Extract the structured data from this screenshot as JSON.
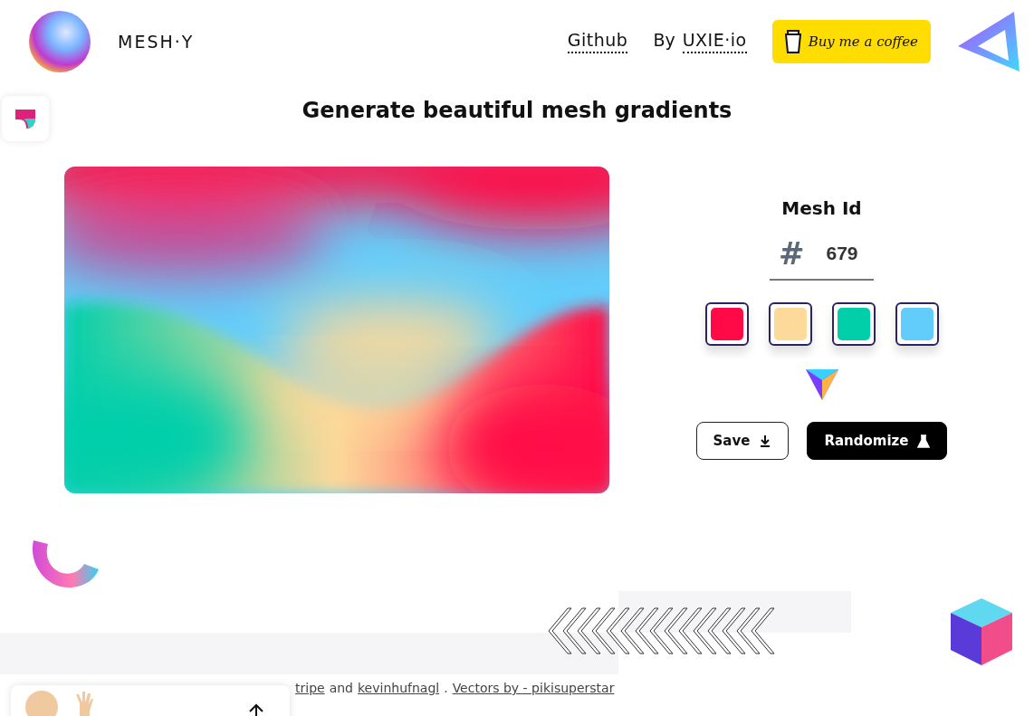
{
  "header": {
    "logo_text": "MESH·Y",
    "github_link": "Github",
    "by_label": "By",
    "by_link": "UXIE·io",
    "coffee_button": "Buy me a coffee"
  },
  "headline": "Generate beautiful mesh gradients",
  "mesh_id": {
    "label": "Mesh Id",
    "prefix": "#",
    "value": "679"
  },
  "swatches": [
    {
      "color": "#ff0a47"
    },
    {
      "color": "#fdd99a"
    },
    {
      "color": "#00cfaa"
    },
    {
      "color": "#62cdfb"
    }
  ],
  "buttons": [
    {
      "label": "Save",
      "kind": "save"
    },
    {
      "label": "Randomize",
      "kind": "randomize"
    }
  ],
  "credits": [
    {
      "text": "tripe",
      "link": true
    },
    {
      "text": "and",
      "link": false
    },
    {
      "text": "kevinhufnagl",
      "link": true
    },
    {
      "text": ".",
      "link": false
    },
    {
      "text": "Vectors by - pikisuperstar",
      "link": true
    }
  ]
}
